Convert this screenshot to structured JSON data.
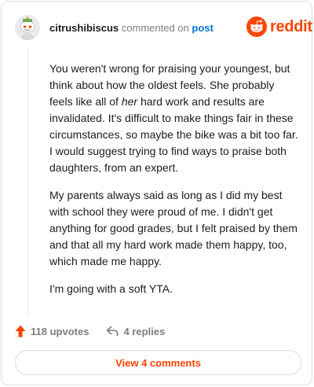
{
  "header": {
    "username": "citrushibiscus",
    "action_text": "commented on",
    "post_link_label": "post",
    "brand_name": "reddit"
  },
  "icons": {
    "avatar": "snoo-avatar",
    "brand": "reddit-logo-icon",
    "upvote": "upvote-arrow-icon",
    "reply": "reply-arrow-icon"
  },
  "colors": {
    "brand": "#ff4500",
    "link": "#0079d3",
    "muted": "#7c7c7c"
  },
  "comment": {
    "p1_before": "You weren't wrong for praising your youngest, but think about how the oldest feels. She probably feels like all of ",
    "p1_emphasis": "her",
    "p1_after": " hard work and results are invalidated. It's difficult to make things fair in these circumstances, so maybe the bike was a bit too far. I would suggest trying to find ways to praise both daughters, from an expert.",
    "p2": "My parents always said as long as I did my best with school they were proud of me. I didn't get anything for good grades, but I felt praised by them and that all my hard work made them happy, too, which made me happy.",
    "p3": "I'm going with a soft YTA."
  },
  "footer": {
    "upvotes_label": "118 upvotes",
    "replies_label": "4 replies"
  },
  "view_button_label": "View 4 comments"
}
